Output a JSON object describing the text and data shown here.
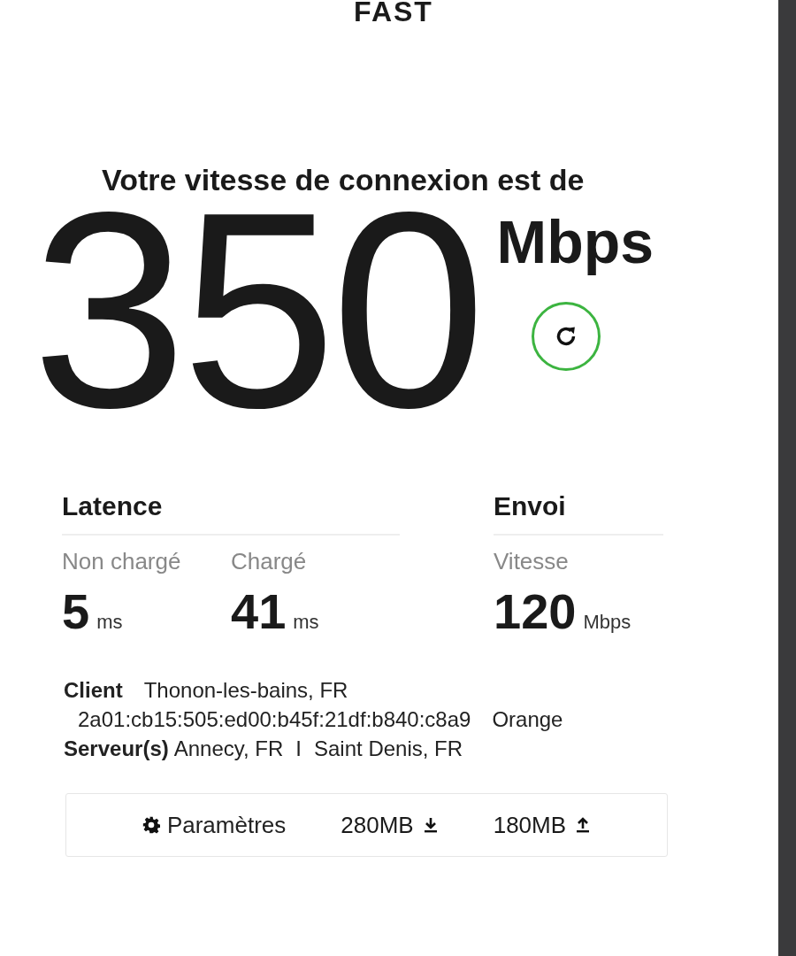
{
  "logo": "FAST",
  "heading": "Votre vitesse de connexion est de",
  "speed": {
    "value": "350",
    "unit": "Mbps"
  },
  "groups": [
    {
      "title": "Latence",
      "items": [
        {
          "label": "Non chargé",
          "value": "5",
          "unit": "ms"
        },
        {
          "label": "Chargé",
          "value": "41",
          "unit": "ms"
        }
      ]
    },
    {
      "title": "Envoi",
      "items": [
        {
          "label": "Vitesse",
          "value": "120",
          "unit": "Mbps"
        }
      ]
    }
  ],
  "client": {
    "label": "Client",
    "location": "Thonon-les-bains, FR",
    "ip": "2a01:cb15:505:ed00:b45f:21df:b840:c8a9",
    "isp": "Orange"
  },
  "servers": {
    "label": "Serveur(s)",
    "list": [
      "Annecy, FR",
      "Saint Denis, FR"
    ],
    "separator": "I"
  },
  "footer": {
    "settings": "Paramètres",
    "download": "280MB",
    "upload": "180MB"
  }
}
